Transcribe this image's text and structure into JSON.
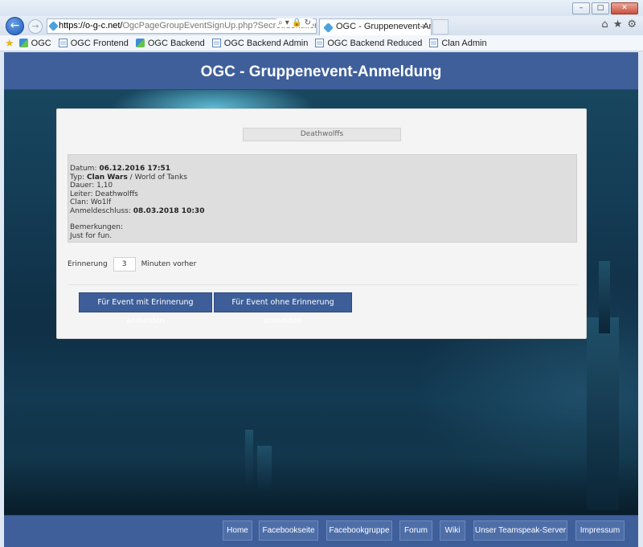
{
  "browser": {
    "address_lead": "https://o-g-c.net/",
    "address_rest": "OgcPageGroupEventSignUp.php?SecretIdentifier=jTVxF",
    "address_tools": "⌕ ▾ 🔒 ↻",
    "tab_title": "OGC - Gruppenevent-Anm...",
    "tab_close": "×",
    "right_icons": [
      "⌂",
      "★",
      "⚙"
    ],
    "window_buttons": [
      "–",
      "□",
      "✕"
    ]
  },
  "favorites": [
    {
      "label": "OGC",
      "icon": "ogc-logo-icon"
    },
    {
      "label": "OGC Frontend",
      "icon": "page-icon"
    },
    {
      "label": "OGC Backend",
      "icon": "ogc-logo-icon"
    },
    {
      "label": "OGC Backend Admin",
      "icon": "page-icon"
    },
    {
      "label": "OGC Backend Reduced",
      "icon": "page-icon"
    },
    {
      "label": "Clan Admin",
      "icon": "page-icon"
    }
  ],
  "page": {
    "title": "OGC - Gruppenevent-Anmeldung",
    "group_name": "Deathwolffs",
    "info": {
      "datum_label": "Datum: ",
      "datum_value": "06.12.2016 17:51",
      "typ_label": "Typ: ",
      "typ_value": "Clan Wars",
      "typ_game": " / World of Tanks",
      "dauer": "Dauer: 1,10",
      "leiter": "Leiter: Deathwolffs",
      "clan": "Clan: Wo1lf",
      "anmeldeschluss_label": "Anmeldeschluss: ",
      "anmeldeschluss_value": "08.03.2018 10:30",
      "bemerkungen_label": "Bemerkungen:",
      "bemerkungen_text": "Just for fun."
    },
    "reminder": {
      "label": "Erinnerung",
      "value": "3",
      "suffix": "Minuten vorher"
    },
    "buttons": {
      "with_reminder": "Für Event mit Erinnerung anmelden",
      "without_reminder": "Für Event ohne Erinnerung anmelden"
    }
  },
  "footer": {
    "links": [
      "Home",
      "Facebookseite",
      "Facebookgruppe",
      "Forum",
      "Wiki",
      "Unser Teamspeak-Server",
      "Impressum"
    ]
  },
  "colors": {
    "header_blue": "#3f5f9b",
    "button_blue": "#3d5e99"
  }
}
